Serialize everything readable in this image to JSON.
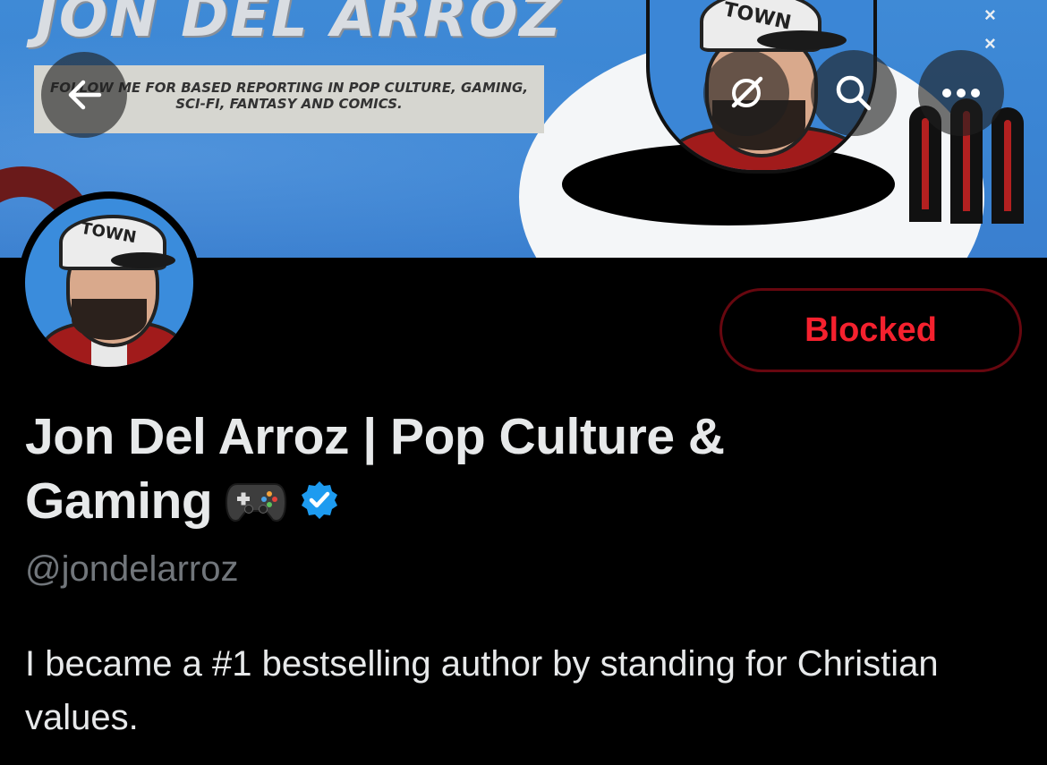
{
  "banner": {
    "title": "JON DEL ARROZ",
    "tagline": "FOLLOW ME FOR BASED REPORTING IN POP CULTURE, GAMING, SCI-FI, FANTASY AND COMICS.",
    "cap_text": "TOWN"
  },
  "nav": {
    "back_icon": "arrow-left-icon",
    "grok_icon": "grok-icon",
    "search_icon": "search-icon",
    "more_icon": "more-icon"
  },
  "profile": {
    "display_name": "Jon Del Arroz | Pop Culture & Gaming",
    "name_line1": "Jon Del Arroz | Pop Culture &",
    "name_line2": "Gaming",
    "handle": "@jondelarroz",
    "bio": "I became a #1 bestselling author by standing for Christian values.",
    "verified": true
  },
  "actions": {
    "blocked_label": "Blocked"
  },
  "colors": {
    "background": "#000000",
    "banner_blue": "#3a84d3",
    "blocked_red": "#f4212e",
    "blocked_border": "#67070f",
    "verified_blue": "#1d9bf0",
    "handle_gray": "#71767b"
  }
}
